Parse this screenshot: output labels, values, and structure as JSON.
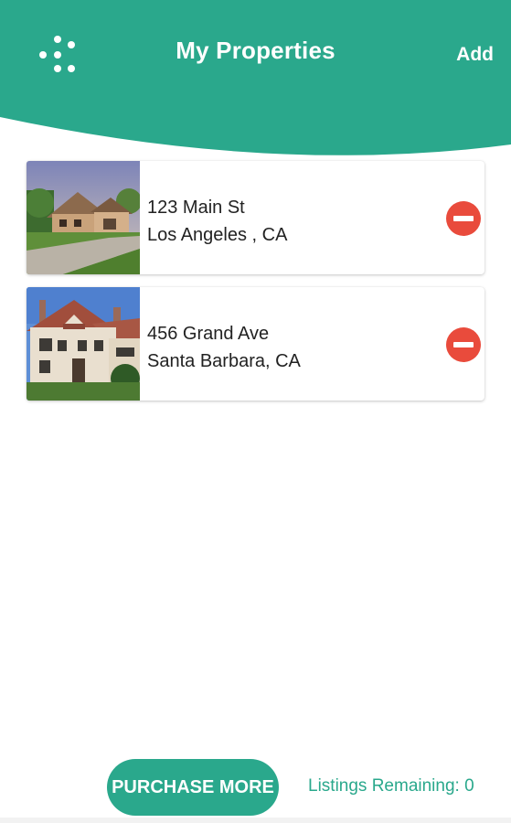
{
  "header": {
    "title": "My Properties",
    "add_label": "Add",
    "menu_icon": "dots-grid-icon",
    "color": "#2aa88c"
  },
  "properties": [
    {
      "street": "123 Main St",
      "city": "Los Angeles , CA",
      "remove_icon": "minus-circle-icon"
    },
    {
      "street": "456 Grand Ave",
      "city": "Santa Barbara, CA",
      "remove_icon": "minus-circle-icon"
    }
  ],
  "footer": {
    "purchase_label": "PURCHASE MORE",
    "remaining_label": "Listings Remaining: 0"
  },
  "colors": {
    "accent": "#2aa88c",
    "remove": "#e94b3c"
  }
}
